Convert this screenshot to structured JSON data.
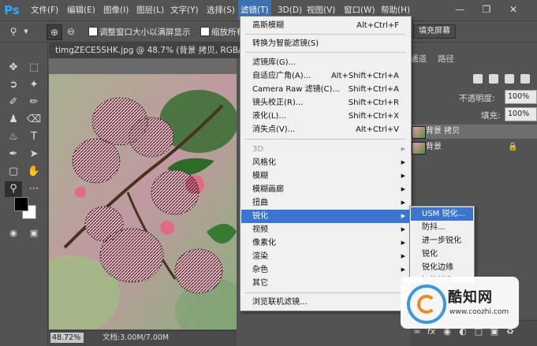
{
  "app": {
    "logo": "Ps"
  },
  "menubar": {
    "items": [
      "文件(F)",
      "编辑(E)",
      "图像(I)",
      "图层(L)",
      "文字(Y)",
      "选择(S)",
      "滤镜(T)",
      "3D(D)",
      "视图(V)",
      "窗口(W)",
      "帮助(H)"
    ],
    "active": "滤镜(T)",
    "window_controls": [
      "minimize-icon",
      "restore-icon",
      "close-icon"
    ]
  },
  "options_bar": {
    "resize_windows_label": "调整窗口大小以满屏显示",
    "zoom_all_label": "缩放所有窗",
    "fill_screen_button": "填充屏幕"
  },
  "document": {
    "tab_title": "timgZECE5SHK.jpg @ 48.7% (背景 拷贝, RGB/8#) *",
    "zoom": "48.72%",
    "doc_size": "文档:3.00M/7.00M"
  },
  "right_panel": {
    "tabs": [
      "通道",
      "路径"
    ],
    "opacity_label": "不透明度:",
    "opacity_value": "100%",
    "fill_label": "填充:",
    "fill_value": "100%",
    "layers": [
      {
        "name": "背景 拷贝",
        "active": true,
        "locked": false
      },
      {
        "name": "背景",
        "active": false,
        "locked": true
      }
    ],
    "bottom_icons": [
      "link-icon",
      "fx-icon",
      "mask-icon",
      "adjustment-icon",
      "group-icon",
      "new-layer-icon",
      "trash-icon"
    ]
  },
  "filter_menu": {
    "top_items": [
      {
        "label": "高斯模糊",
        "shortcut": "Alt+Ctrl+F"
      },
      {
        "label": "转换为智能滤镜(S)",
        "shortcut": ""
      }
    ],
    "group2": [
      {
        "label": "滤镜库(G)...",
        "shortcut": ""
      },
      {
        "label": "自适应广角(A)...",
        "shortcut": "Alt+Shift+Ctrl+A"
      },
      {
        "label": "Camera Raw 滤镜(C)...",
        "shortcut": "Shift+Ctrl+A"
      },
      {
        "label": "镜头校正(R)...",
        "shortcut": "Shift+Ctrl+R"
      },
      {
        "label": "液化(L)...",
        "shortcut": "Shift+Ctrl+X"
      },
      {
        "label": "消失点(V)...",
        "shortcut": "Alt+Ctrl+V"
      }
    ],
    "group3": [
      {
        "label": "3D",
        "disabled": true
      },
      {
        "label": "风格化",
        "disabled": false
      },
      {
        "label": "模糊",
        "disabled": false
      },
      {
        "label": "模糊画廊",
        "disabled": false
      },
      {
        "label": "扭曲",
        "disabled": false
      },
      {
        "label": "锐化",
        "disabled": false,
        "highlighted": true
      },
      {
        "label": "视频",
        "disabled": false
      },
      {
        "label": "像素化",
        "disabled": false
      },
      {
        "label": "渲染",
        "disabled": false
      },
      {
        "label": "杂色",
        "disabled": false
      },
      {
        "label": "其它",
        "disabled": false
      }
    ],
    "bottom_item": "浏览联机滤镜..."
  },
  "sharpen_submenu": {
    "items": [
      "USM 锐化...",
      "防抖...",
      "进一步锐化",
      "锐化",
      "锐化边缘",
      "智能锐化..."
    ],
    "highlighted": "USM 锐化..."
  },
  "watermark": {
    "title": "酷知网",
    "url": "www.coozhi.com"
  },
  "colors": {
    "menu_highlight": "#3c75d0",
    "panel_bg": "#535353",
    "menu_bg": "#f0f0f0",
    "watermark_blue": "#3a9bd8",
    "watermark_orange": "#f08a24"
  }
}
